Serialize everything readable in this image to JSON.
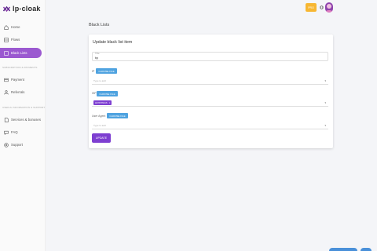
{
  "app": {
    "logo_text": "lp-cloak"
  },
  "sidebar": {
    "items": [
      {
        "label": "Home"
      },
      {
        "label": "Flows"
      },
      {
        "label": "Black Lists"
      },
      {
        "label": "Payment"
      },
      {
        "label": "Referrals"
      },
      {
        "label": "Services & bonuses"
      },
      {
        "label": "FAQ"
      },
      {
        "label": "Support"
      }
    ],
    "sections": [
      "SUBSCRIPTION & PAYMENTS",
      "USEFUL INFORMATION & SUPPORT"
    ]
  },
  "topbar": {
    "button_label": "PRO"
  },
  "page": {
    "title": "Black Lists"
  },
  "card": {
    "title": "Update black list item",
    "title_field": {
      "label": "Title",
      "value": "bp"
    },
    "ip": {
      "label": "IP",
      "choose": "CHOOSE FILE",
      "placeholder": "Type to add"
    },
    "isp": {
      "label": "ISP",
      "choose": "CHOOSE FILE",
      "chip": "HOSTINGS",
      "chip_remove": "×"
    },
    "ua": {
      "label": "User Agent",
      "choose": "CHOOSE FILE",
      "placeholder": "Type to add"
    },
    "update_label": "UPDATE"
  },
  "colors": {
    "accent": "#7e3fd1",
    "active_nav": "#9b59d0",
    "file_button": "#4fa3e0",
    "top_button": "#f7b733"
  }
}
